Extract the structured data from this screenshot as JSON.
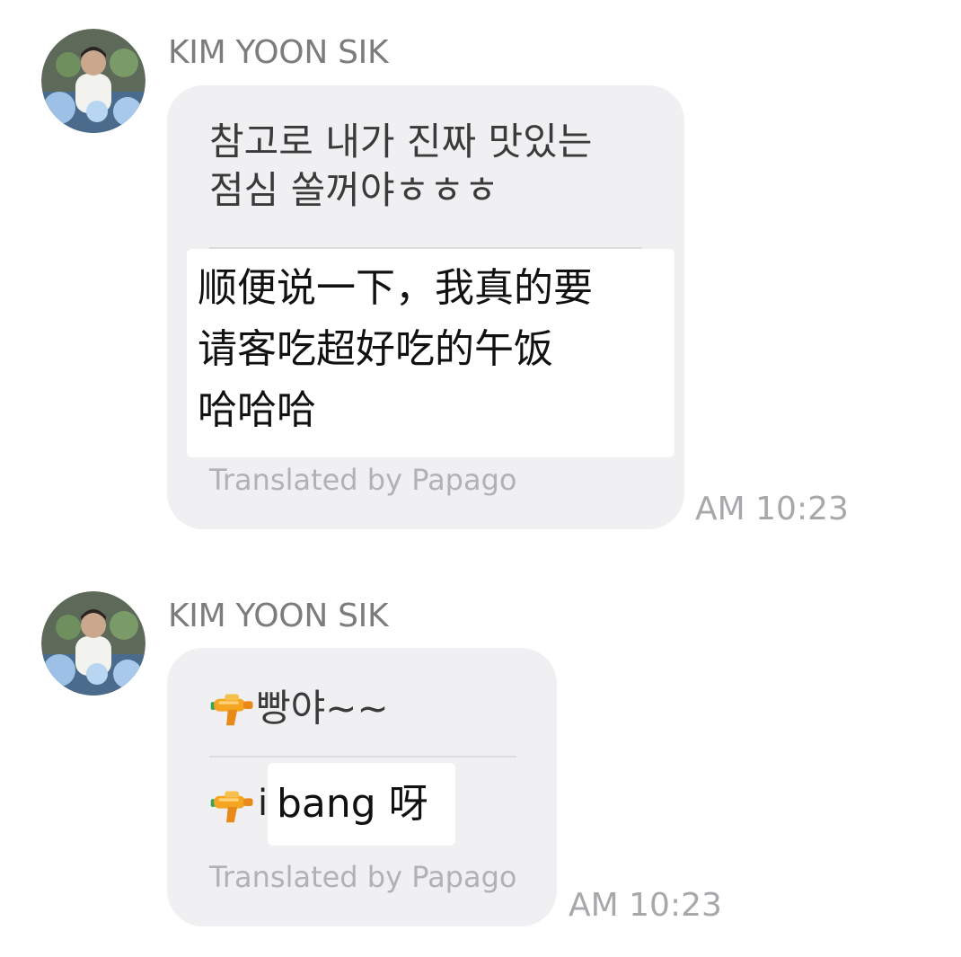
{
  "messages": [
    {
      "sender": "KIM YOON SIK",
      "original_text": "참고로 내가 진짜 맛있는\n점심 쏠꺼야ㅎㅎㅎ",
      "translated_text": "顺便说一下，我真的要\n请客吃超好吃的午饭\n哈哈哈",
      "translation_credit": "Translated by Papago",
      "time": "AM 10:23"
    },
    {
      "sender": "KIM YOON SIK",
      "original_text": "빵야~~",
      "original_icon": "water-gun-icon",
      "translated_prefix": "i",
      "translated_text": "bang 呀",
      "translated_icon": "water-gun-icon",
      "translation_credit": "Translated by Papago",
      "time": "AM 10:23"
    }
  ],
  "colors": {
    "bubble": "#f0f0f2",
    "translation_background": "#ffffff",
    "sender": "#7c7c7c",
    "timestamp": "#a8a8ac"
  }
}
